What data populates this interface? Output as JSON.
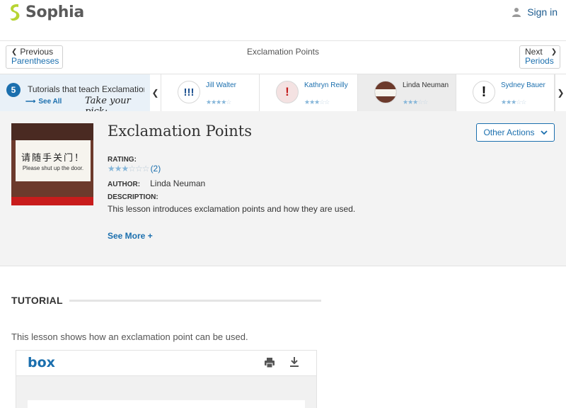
{
  "header": {
    "brand": "Sophia",
    "signin_label": "Sign in"
  },
  "nav": {
    "prev_label": "Previous",
    "prev_target": "Parentheses",
    "title": "Exclamation Points",
    "next_label": "Next",
    "next_target": "Periods"
  },
  "carousel": {
    "count": "5",
    "intro_title": "Tutorials that teach Exclamation Points",
    "see_all": "See All",
    "take_pick": "Take your pick:",
    "items": [
      {
        "name": "Jill Walter",
        "thumb": "!!!",
        "stars_on": "★★★★",
        "stars_off": "☆"
      },
      {
        "name": "Kathryn Reilly",
        "thumb": "!",
        "stars_on": "★★★",
        "stars_off": "☆☆"
      },
      {
        "name": "Linda Neuman",
        "thumb": "",
        "stars_on": "★★★",
        "stars_off": "☆☆"
      },
      {
        "name": "Sydney Bauer",
        "thumb": "!",
        "stars_on": "★★★",
        "stars_off": "☆☆"
      }
    ]
  },
  "lesson": {
    "image_sign_cn": "请随手关门！",
    "image_sign_en": "Please shut up the door.",
    "title": "Exclamation Points",
    "rating_label": "RATING:",
    "stars_on": "★★★",
    "stars_off": "☆☆☆",
    "rating_count": "(2)",
    "author_label": "AUTHOR:",
    "author": "Linda Neuman",
    "description_label": "DESCRIPTION:",
    "description": "This lesson introduces exclamation points and how they are used.",
    "see_more": "See More +",
    "other_actions": "Other Actions"
  },
  "tutorial": {
    "heading": "TUTORIAL",
    "description": "This lesson shows how an exclamation point can be used.",
    "embed_brand": "box"
  },
  "colors": {
    "link": "#1b6fae",
    "brand_green": "#b7d433",
    "panel_bg": "#f3f3f3"
  }
}
